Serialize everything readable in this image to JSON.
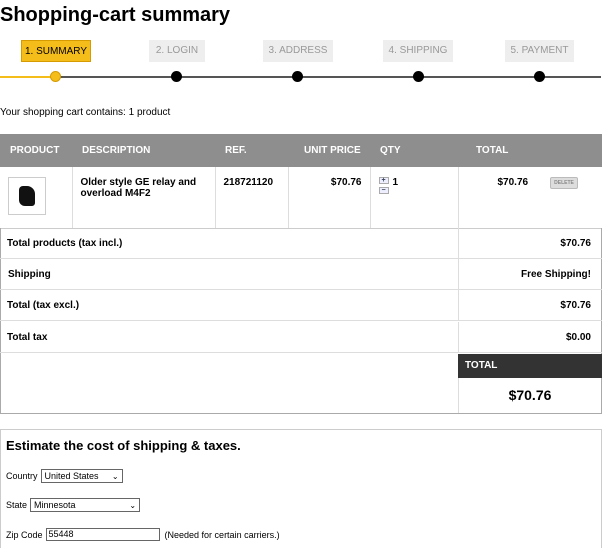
{
  "page": {
    "title": "Shopping-cart summary"
  },
  "steps": [
    {
      "label": "1. SUMMARY",
      "active": true
    },
    {
      "label": "2. LOGIN",
      "active": false
    },
    {
      "label": "3. ADDRESS",
      "active": false
    },
    {
      "label": "4. SHIPPING",
      "active": false
    },
    {
      "label": "5. PAYMENT",
      "active": false
    }
  ],
  "cart": {
    "count_text": "Your shopping cart contains: 1 product",
    "headers": [
      "PRODUCT",
      "DESCRIPTION",
      "REF.",
      "UNIT PRICE",
      "QTY",
      "TOTAL"
    ],
    "items": [
      {
        "description": "Older style GE relay and overload M4F2",
        "ref": "218721120",
        "unit_price": "$70.76",
        "qty": "1",
        "total": "$70.76",
        "delete_label": "DELETE"
      }
    ]
  },
  "totals": {
    "products_label": "Total products (tax incl.)",
    "products_value": "$70.76",
    "shipping_label": "Shipping",
    "shipping_value": "Free Shipping!",
    "tax_excl_label": "Total (tax excl.)",
    "tax_excl_value": "$70.76",
    "tax_label": "Total tax",
    "tax_value": "$0.00",
    "grand_label": "TOTAL",
    "grand_value": "$70.76"
  },
  "estimate": {
    "title": "Estimate the cost of shipping & taxes.",
    "country_label": "Country",
    "country_value": "United States",
    "state_label": "State",
    "state_value": "Minnesota",
    "zip_label": "Zip Code",
    "zip_value": "55448",
    "zip_note": "(Needed for certain carriers.)"
  },
  "colors": {
    "accent": "#f5bd1a",
    "header_gray": "#8e8e8e",
    "total_dark": "#333333"
  },
  "icons": {
    "qty_up": "plus-icon",
    "qty_down": "minus-icon",
    "select_arrow": "chevron-down-icon"
  }
}
